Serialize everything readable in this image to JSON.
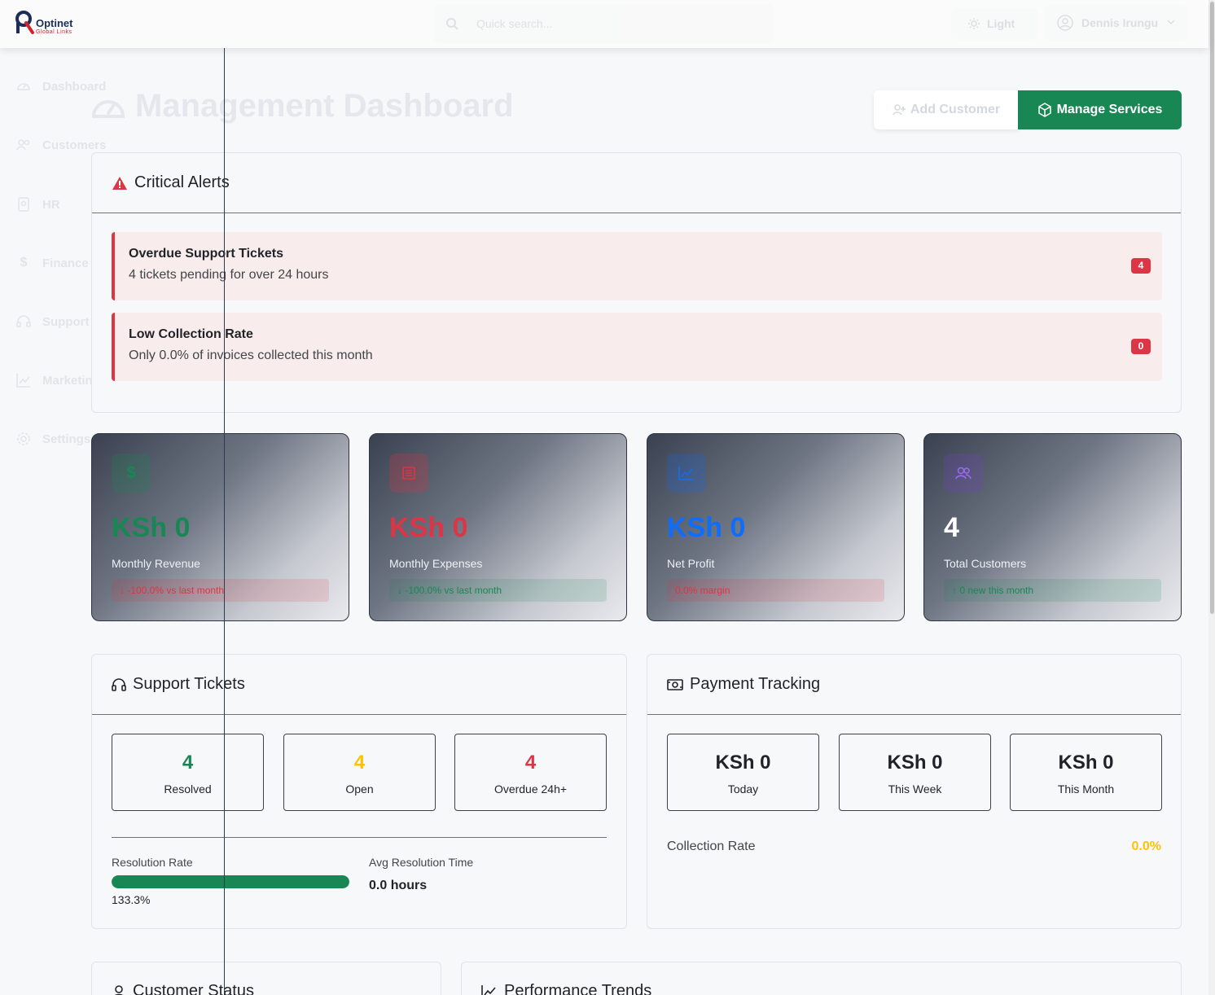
{
  "brand": {
    "name": "Optinet",
    "tagline": "Global Links"
  },
  "topbar": {
    "search_placeholder": "Quick search...",
    "theme_label": "Light",
    "user_name": "Dennis Irungu"
  },
  "sidebar": {
    "items": [
      {
        "label": "Dashboard",
        "icon": "speedometer-icon"
      },
      {
        "label": "Customers",
        "icon": "people-icon"
      },
      {
        "label": "HR",
        "icon": "badge-icon"
      },
      {
        "label": "Finance",
        "icon": "dollar-icon"
      },
      {
        "label": "Support",
        "icon": "headset-icon"
      },
      {
        "label": "Marketing",
        "icon": "graph-icon"
      },
      {
        "label": "Settings",
        "icon": "gear-icon"
      }
    ]
  },
  "header": {
    "title": "Management Dashboard",
    "add_customer_label": "Add Customer",
    "manage_services_label": "Manage Services"
  },
  "alerts": {
    "title": "Critical Alerts",
    "items": [
      {
        "title": "Overdue Support Tickets",
        "desc": "4 tickets pending for over 24 hours",
        "badge": "4"
      },
      {
        "title": "Low Collection Rate",
        "desc": "Only 0.0% of invoices collected this month",
        "badge": "0"
      }
    ]
  },
  "stats": [
    {
      "value": "KSh 0",
      "label": "Monthly Revenue",
      "change": "↓ -100.0% vs last month",
      "color": "#198754"
    },
    {
      "value": "KSh 0",
      "label": "Monthly Expenses",
      "change": "↓ -100.0% vs last month",
      "color": "#dc3545"
    },
    {
      "value": "KSh 0",
      "label": "Net Profit",
      "change": "0.0% margin",
      "color": "#0d6efd"
    },
    {
      "value": "4",
      "label": "Total Customers",
      "change": "↑ 0 new this month",
      "color": "#ffffff"
    }
  ],
  "support": {
    "title": "Support Tickets",
    "boxes": [
      {
        "value": "4",
        "label": "Resolved",
        "color": "#198754"
      },
      {
        "value": "4",
        "label": "Open",
        "color": "#ffc107"
      },
      {
        "value": "4",
        "label": "Overdue 24h+",
        "color": "#dc3545"
      }
    ],
    "resolution_rate_label": "Resolution Rate",
    "resolution_rate": "133.3%",
    "resolution_rate_fill": 1.0,
    "avg_time_label": "Avg Resolution Time",
    "avg_time": "0.0 hours"
  },
  "payments": {
    "title": "Payment Tracking",
    "boxes": [
      {
        "value": "KSh 0",
        "label": "Today"
      },
      {
        "value": "KSh 0",
        "label": "This Week"
      },
      {
        "value": "KSh 0",
        "label": "This Month"
      }
    ],
    "collection_rate_label": "Collection Rate",
    "collection_rate": "0.0%"
  },
  "bottom": {
    "customer_status_title": "Customer Status",
    "performance_title": "Performance Trends"
  },
  "colors": {
    "accent": "#198754",
    "danger": "#dc3545",
    "warning": "#ffc107",
    "primary": "#0d6efd"
  }
}
